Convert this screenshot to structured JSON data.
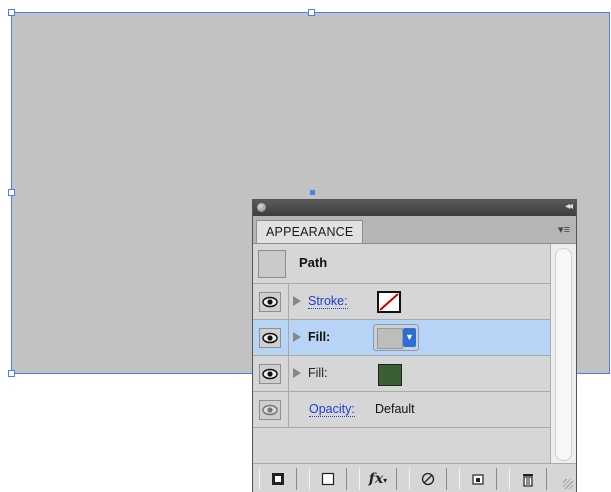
{
  "panel": {
    "tab_label": "APPEARANCE",
    "collapse_icon": "double-chevron-icon",
    "menu_icon": "panel-menu-icon",
    "object_type": "Path",
    "rows": [
      {
        "label": "Stroke:",
        "style": "link",
        "swatch": "none-stroke"
      },
      {
        "label": "Fill:",
        "style": "bold",
        "swatch": "gray-dropdown",
        "selected": true
      },
      {
        "label": "Fill:",
        "style": "plain",
        "swatch": "green"
      },
      {
        "label": "Opacity:",
        "value": "Default"
      }
    ],
    "toolbar": [
      "add-new-stroke-icon",
      "add-new-fill-icon",
      "add-new-effect-icon",
      "clear-appearance-icon",
      "duplicate-item-icon",
      "delete-item-icon"
    ]
  },
  "colors": {
    "shape_fill": "#c2c2c2",
    "selection": "#4a7ff0",
    "selected_row": "#b7d3f6",
    "green_swatch": "#3a5f32",
    "link_text": "#1d3fd0"
  }
}
